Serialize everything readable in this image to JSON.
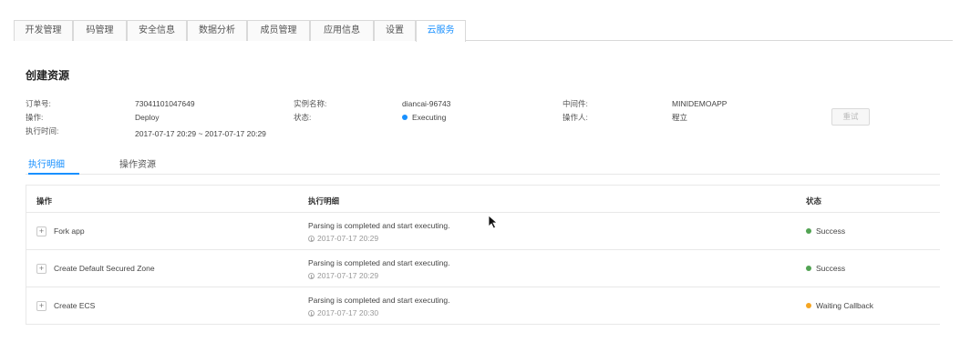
{
  "top_tabs": [
    {
      "label": "开发管理",
      "active": false
    },
    {
      "label": "码管理",
      "active": false
    },
    {
      "label": "安全信息",
      "active": false
    },
    {
      "label": "数据分析",
      "active": false
    },
    {
      "label": "成员管理",
      "active": false
    },
    {
      "label": "应用信息",
      "active": false
    },
    {
      "label": "设置",
      "active": false
    },
    {
      "label": "云服务",
      "active": true
    }
  ],
  "section_title": "创建资源",
  "info": {
    "order_no_label": "订单号:",
    "order_no": "73041101047649",
    "operation_label": "操作:",
    "operation": "Deploy",
    "exec_time_label": "执行时间:",
    "exec_time": "2017-07-17 20:29 ~ 2017-07-17 20:29",
    "instance_label": "实例名称:",
    "instance": "diancai-96743",
    "state_label": "状态:",
    "state": "Executing",
    "middleware_label": "中间件:",
    "middleware": "MINIDEMOAPP",
    "operator_label": "操作人:",
    "operator": "程立",
    "retry_label": "重试"
  },
  "sub_tabs": [
    {
      "label": "执行明细",
      "active": true
    },
    {
      "label": "操作资源",
      "active": false
    }
  ],
  "table": {
    "headers": {
      "operation": "操作",
      "detail": "执行明细",
      "status": "状态"
    },
    "rows": [
      {
        "expand": "+",
        "operation": "Fork app",
        "detail": "Parsing is completed and start executing.",
        "time": "2017-07-17 20:29",
        "status": "Success",
        "status_color": "#52a353"
      },
      {
        "expand": "+",
        "operation": "Create Default Secured Zone",
        "detail": "Parsing is completed and start executing.",
        "time": "2017-07-17 20:29",
        "status": "Success",
        "status_color": "#52a353"
      },
      {
        "expand": "+",
        "operation": "Create ECS",
        "detail": "Parsing is completed and start executing.",
        "time": "2017-07-17 20:30",
        "status": "Waiting Callback",
        "status_color": "#f5a623"
      }
    ]
  },
  "colors": {
    "accent": "#1890ff",
    "executing": "#1890ff"
  }
}
